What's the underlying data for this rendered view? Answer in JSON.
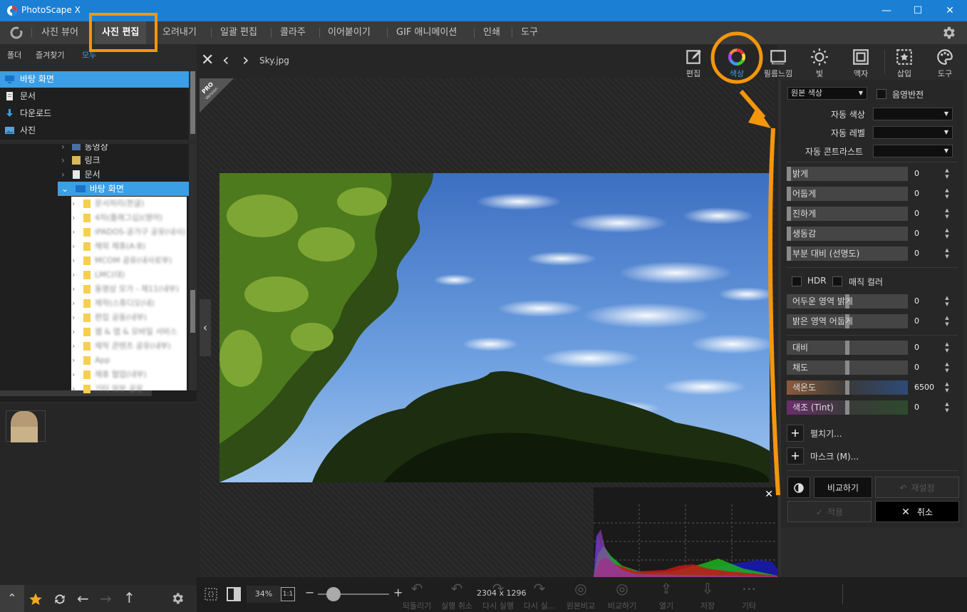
{
  "window": {
    "title": "PhotoScape X",
    "controls": {
      "minimize": "—",
      "maximize": "☐",
      "close": "✕"
    }
  },
  "menu": {
    "items": [
      "사진 뷰어",
      "사진 편집",
      "오려내기",
      "일괄 편집",
      "콜라주",
      "이어붙이기",
      "GIF 애니메이션",
      "인쇄",
      "도구"
    ],
    "active": "사진 편집"
  },
  "left_panel": {
    "tabs": [
      "폴더",
      "즐겨찾기",
      "모두"
    ],
    "favorites": [
      {
        "label": "바탕 화면",
        "icon": "desktop-icon",
        "selected": true
      },
      {
        "label": "문서",
        "icon": "document-icon"
      },
      {
        "label": "다운로드",
        "icon": "download-icon"
      },
      {
        "label": "사진",
        "icon": "pictures-icon"
      }
    ],
    "tree": [
      {
        "label": "동영상",
        "icon": "video-icon"
      },
      {
        "label": "링크",
        "icon": "link-icon"
      },
      {
        "label": "문서",
        "icon": "document-icon"
      },
      {
        "label": "바탕 화면",
        "icon": "desktop-icon",
        "selected": true
      }
    ],
    "subfolders": [
      "문서처리(한글)",
      "4차(플래그십)(영어)",
      "iPADOS-공가구 공유(내사)",
      "해외 제휴(A·B)",
      "MCOM 공유(내사로부)",
      "LMC(대)",
      "동영상 모가 - 제11(내부)",
      "제작(스튜디오(내)",
      "편집 공동(내부)",
      "웹 & 앱 & 모바일 서비스",
      "제작 콘텐츠 공유(내부)",
      "App",
      "제휴 협업(내부)",
      "기타 외부 공유"
    ]
  },
  "editor": {
    "filename": "Sky.jpg",
    "pro_badge_main": "PRO",
    "pro_badge_sub": "Version",
    "dimensions": "2304 x 1296",
    "zoom": "34%",
    "zoom_fit": "1:1",
    "zoom_level": 0.22
  },
  "toolbar": [
    {
      "label": "편집",
      "icon": "edit-icon"
    },
    {
      "label": "색상",
      "icon": "color-wheel-icon",
      "active": true
    },
    {
      "label": "필름느낌",
      "icon": "film-icon"
    },
    {
      "label": "빛",
      "icon": "light-icon"
    },
    {
      "label": "액자",
      "icon": "frame-icon"
    },
    {
      "label": "삽입",
      "icon": "insert-icon"
    },
    {
      "label": "도구",
      "icon": "tools-icon"
    }
  ],
  "color_panel": {
    "preset": "원본 색상",
    "invert_label": "음영반전",
    "auto_color_label": "자동 색상",
    "auto_level_label": "자동 레벨",
    "auto_contrast_label": "자동 콘트라스트",
    "sliders_top": [
      {
        "label": "밝게",
        "value": "0"
      },
      {
        "label": "어둡게",
        "value": "0"
      },
      {
        "label": "진하게",
        "value": "0"
      },
      {
        "label": "생동감",
        "value": "0"
      },
      {
        "label": "부분 대비 (선명도)",
        "value": "0"
      }
    ],
    "hdr_label": "HDR",
    "magic_color_label": "매직 컬러",
    "sliders_mid": [
      {
        "label": "어두운 영역 밝게",
        "value": "0"
      },
      {
        "label": "밝은 영역 어둡게",
        "value": "0"
      }
    ],
    "sliders_bottom": [
      {
        "label": "대비",
        "value": "0"
      },
      {
        "label": "채도",
        "value": "0"
      },
      {
        "label": "색온도",
        "value": "6500"
      },
      {
        "label": "색조 (Tint)",
        "value": "0"
      }
    ],
    "expand_label": "펼치기...",
    "mask_label": "마스크 (M)...",
    "compare_label": "비교하기",
    "reset_label": "재설정",
    "apply_label": "적용",
    "cancel_label": "취소"
  },
  "bottom_actions": [
    "되돌리기",
    "실행 취소",
    "다시 실행",
    "다시 실...",
    "원본비교",
    "비교하기",
    "열기",
    "저장",
    "기타"
  ],
  "colors": {
    "titlebar": "#1b7fd4",
    "accent": "#3b9fe5",
    "annotation": "#f5960c"
  }
}
